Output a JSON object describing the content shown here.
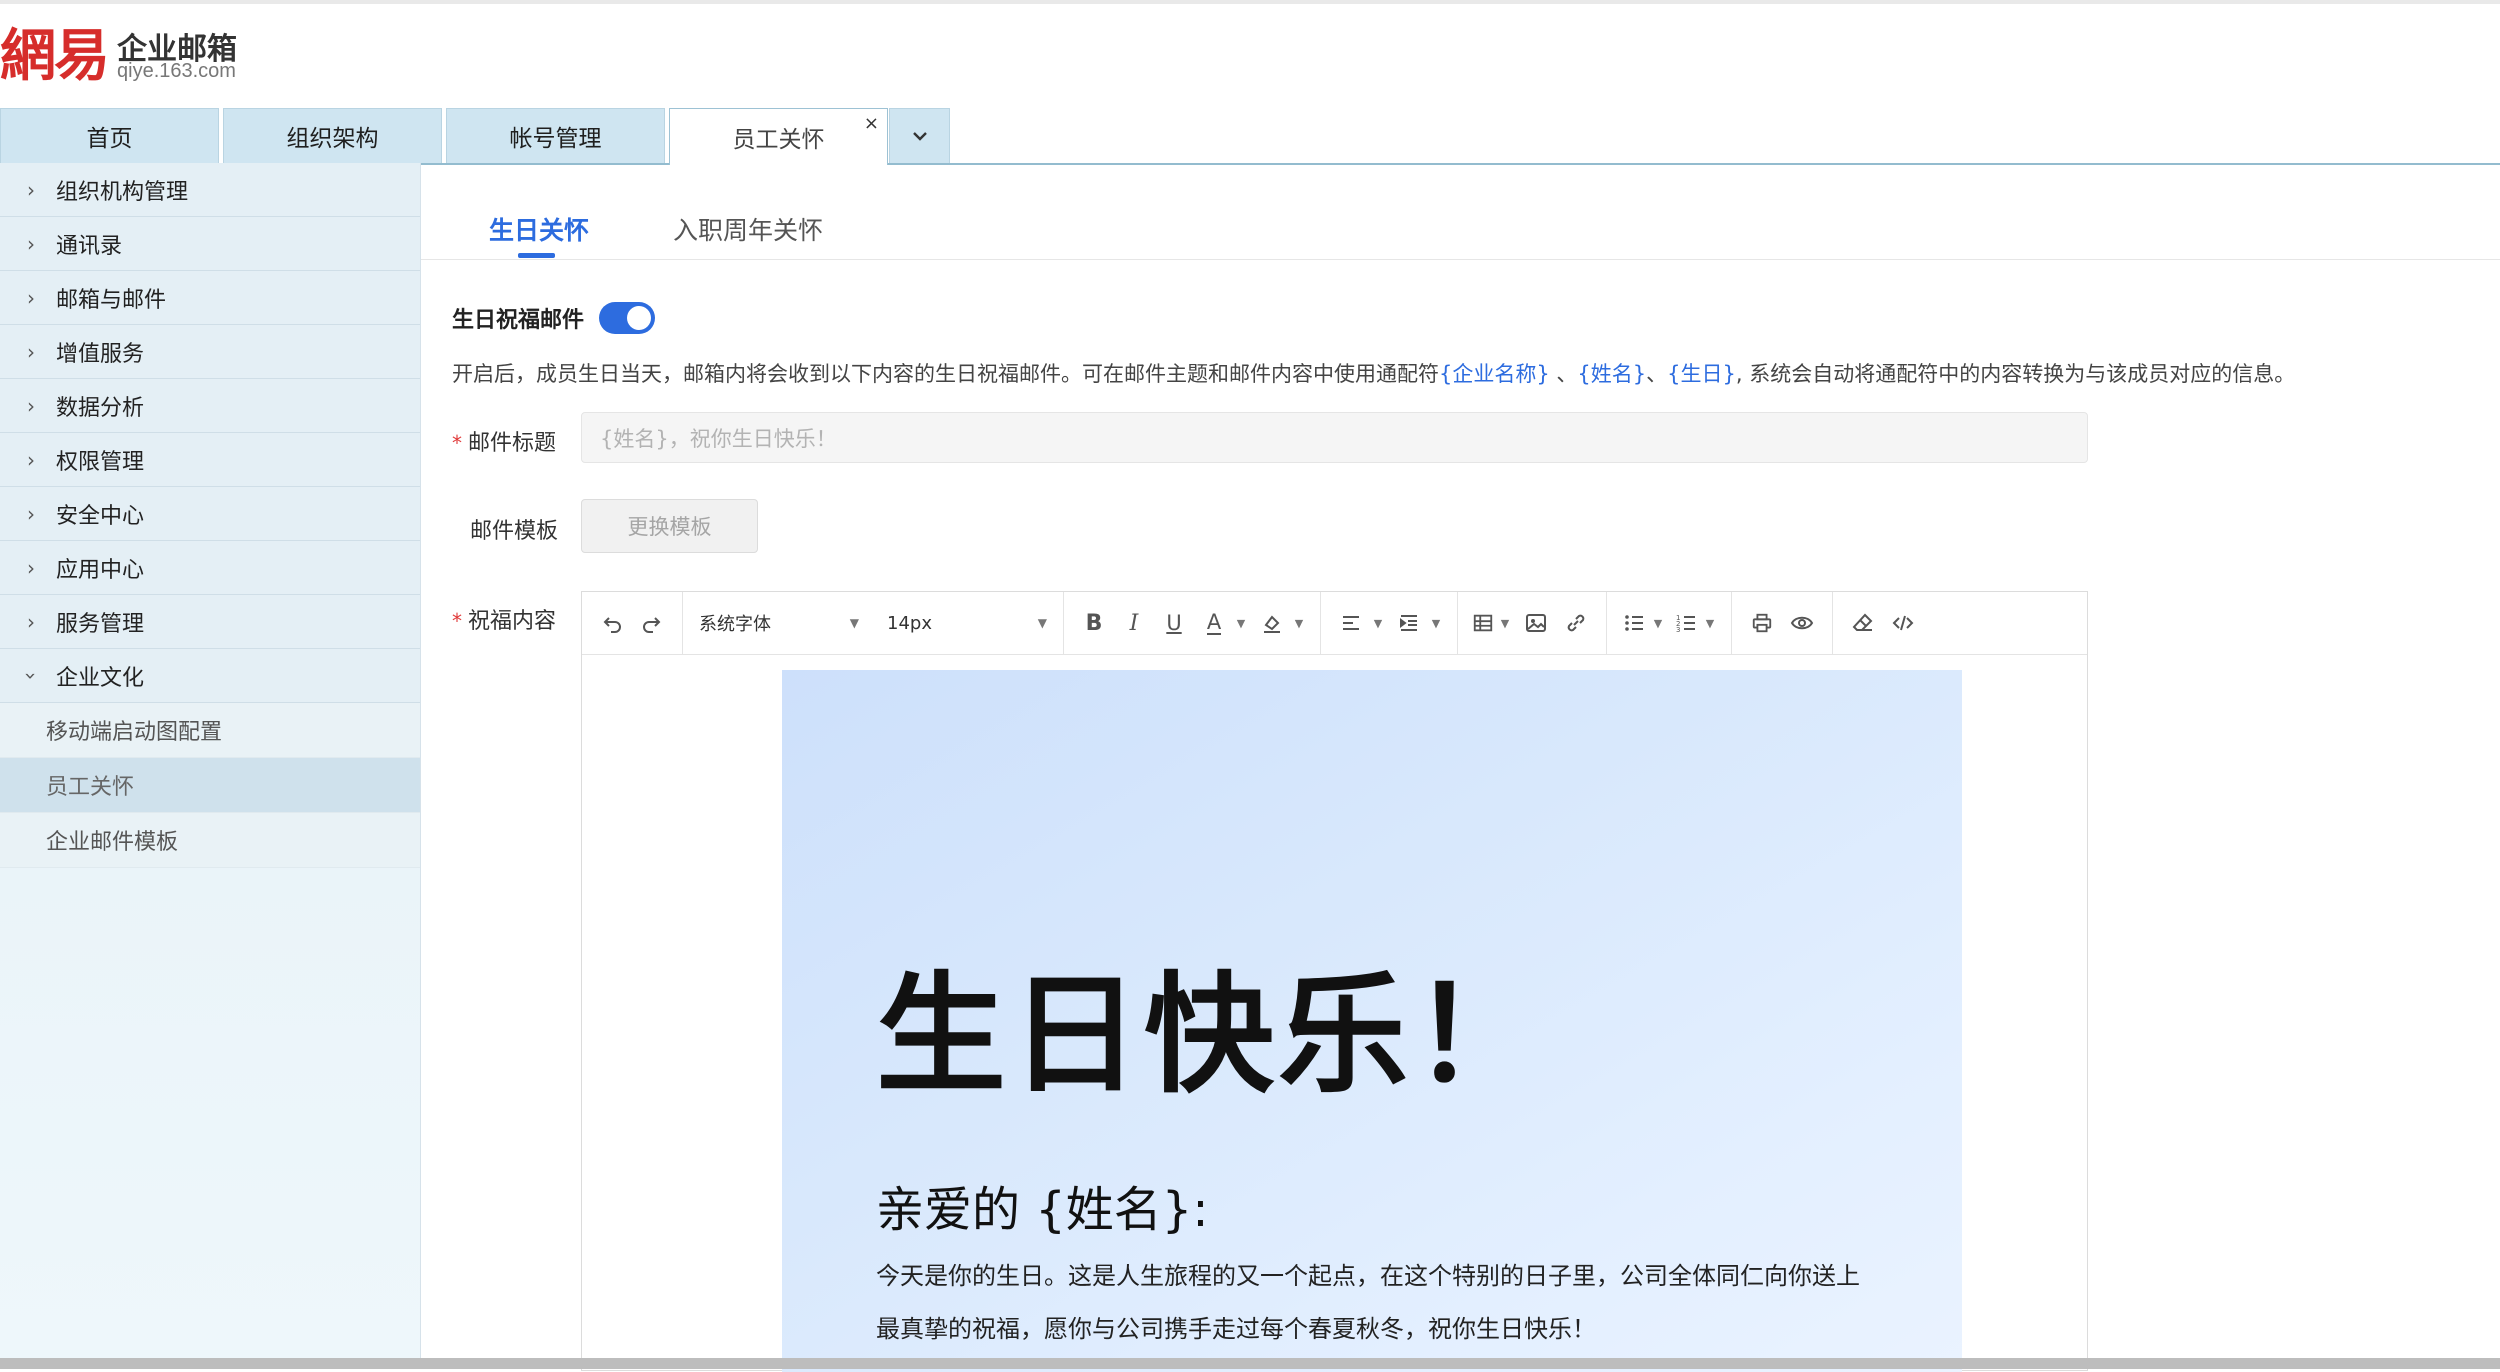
{
  "logo": {
    "mark": "網易",
    "title": "企业邮箱",
    "subtitle": "qiye.163.com"
  },
  "top_tabs": [
    {
      "label": "首页"
    },
    {
      "label": "组织架构"
    },
    {
      "label": "帐号管理"
    },
    {
      "label": "员工关怀",
      "active": true,
      "close": "×"
    }
  ],
  "sidebar": {
    "items": [
      {
        "label": "组织机构管理"
      },
      {
        "label": "通讯录"
      },
      {
        "label": "邮箱与邮件"
      },
      {
        "label": "增值服务"
      },
      {
        "label": "数据分析"
      },
      {
        "label": "权限管理"
      },
      {
        "label": "安全中心"
      },
      {
        "label": "应用中心"
      },
      {
        "label": "服务管理"
      },
      {
        "label": "企业文化",
        "expanded": true
      }
    ],
    "sub_items": [
      {
        "label": "移动端启动图配置"
      },
      {
        "label": "员工关怀",
        "active": true
      },
      {
        "label": "企业邮件模板"
      }
    ]
  },
  "sub_tabs": [
    {
      "label": "生日关怀",
      "active": true
    },
    {
      "label": "入职周年关怀"
    }
  ],
  "birthday_mail": {
    "toggle_label": "生日祝福邮件",
    "enabled": true,
    "desc_prefix": "开启后，成员生日当天，邮箱内将会收到以下内容的生日祝福邮件。可在邮件主题和邮件内容中使用通配符",
    "token_company": "{企业名称}",
    "sep1": " 、",
    "token_name": "{姓名}",
    "sep2": "、",
    "token_birthday": "{生日}",
    "desc_suffix": ", 系统会自动将通配符中的内容转换为与该成员对应的信息。"
  },
  "form": {
    "required_mark": "*",
    "subject_label": "邮件标题",
    "subject_placeholder": "{姓名}，祝你生日快乐！",
    "template_label": "邮件模板",
    "template_button": "更换模板",
    "content_label": "祝福内容"
  },
  "editor": {
    "font_family": "系统字体",
    "font_size": "14px",
    "toolbar_icons": [
      "undo-icon",
      "redo-icon",
      "bold-icon",
      "italic-icon",
      "underline-icon",
      "font-color-icon",
      "highlight-icon",
      "align-icon",
      "indent-icon",
      "table-icon",
      "image-icon",
      "link-icon",
      "bullet-list-icon",
      "numbered-list-icon",
      "print-icon",
      "preview-icon",
      "clear-format-icon",
      "source-code-icon"
    ]
  },
  "letter": {
    "title": "生日快乐！",
    "greeting": "亲爱的 {姓名}:",
    "body": "今天是你的生日。这是人生旅程的又一个起点，在这个特别的日子里，公司全体同仁向你送上最真挚的祝福，愿你与公司携手走过每个春夏秋冬，祝你生日快乐！"
  },
  "colors": {
    "accent": "#2d6cdf",
    "brand_red": "#d62d2b",
    "tab_bg": "#cfe5f1",
    "required": "#e03a3a"
  }
}
